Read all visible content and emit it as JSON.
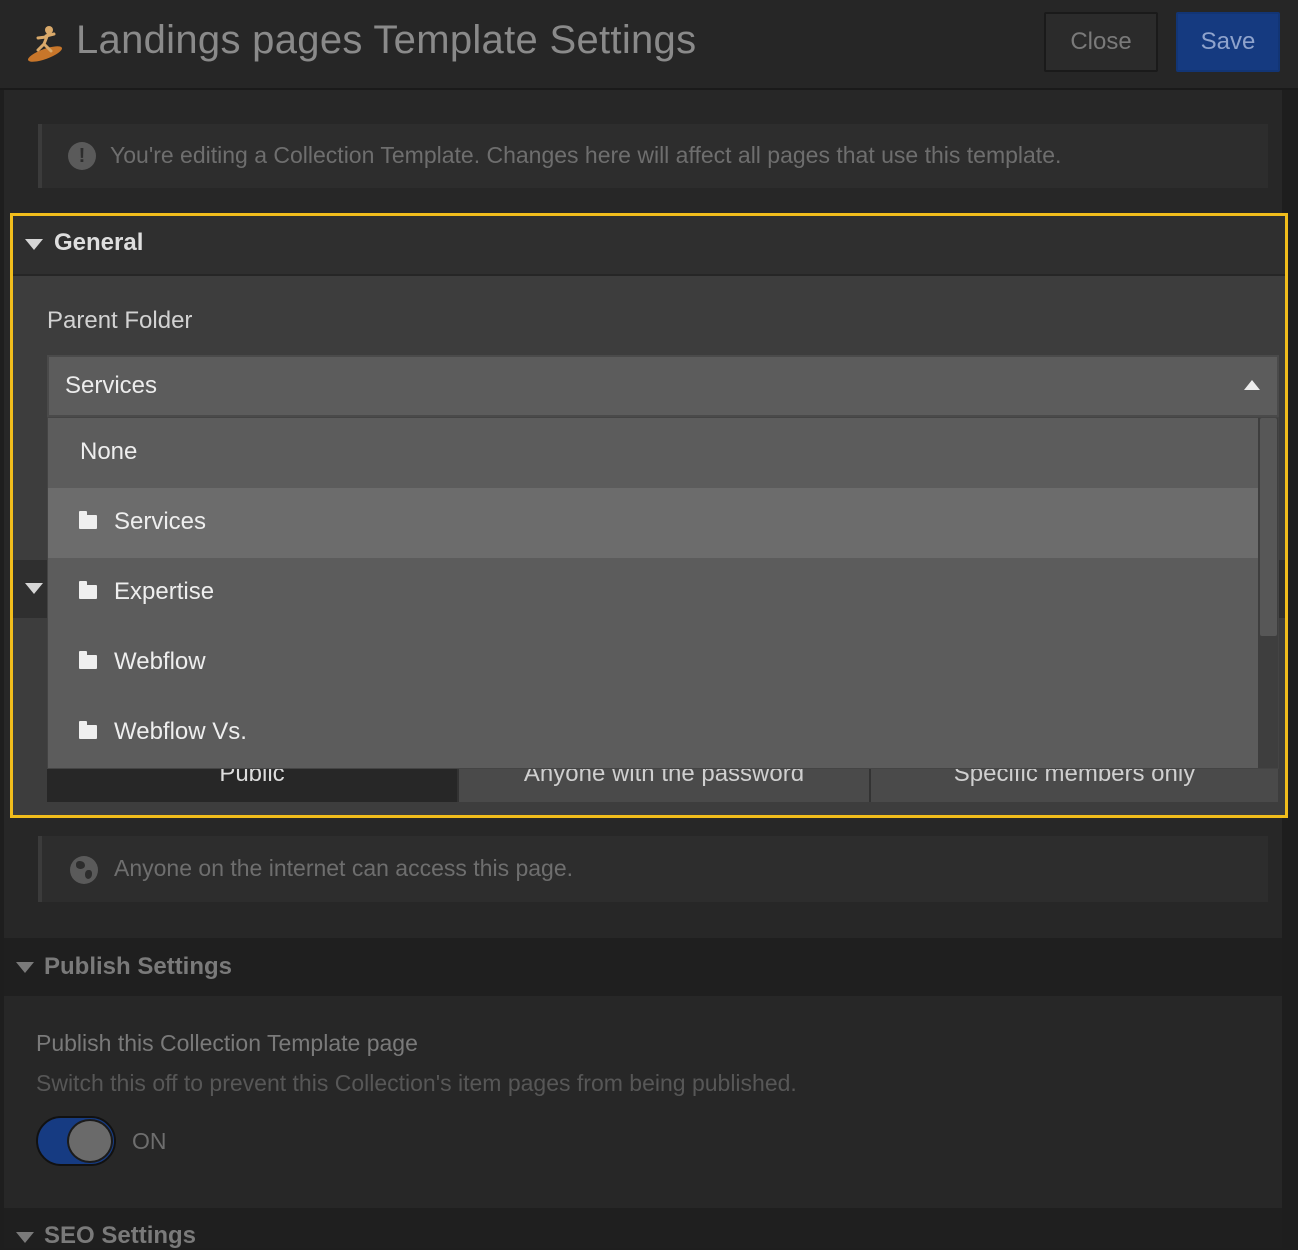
{
  "header": {
    "title": "Landings pages Template Settings",
    "close_label": "Close",
    "save_label": "Save"
  },
  "notice": {
    "text": "You're editing a Collection Template. Changes here will affect all pages that use this template."
  },
  "general": {
    "title": "General",
    "parent_folder_label": "Parent Folder",
    "parent_folder_value": "Services",
    "options": [
      {
        "label": "None"
      },
      {
        "label": "Services"
      },
      {
        "label": "Expertise"
      },
      {
        "label": "Webflow"
      },
      {
        "label": "Webflow Vs."
      }
    ],
    "access_options": [
      "Public",
      "Anyone with the password",
      "Specific members only"
    ]
  },
  "access_notice": {
    "text": "Anyone on the internet can access this page."
  },
  "publish": {
    "title": "Publish Settings",
    "setting_title": "Publish this Collection Template page",
    "setting_desc": "Switch this off to prevent this Collection's item pages from being published.",
    "toggle_state": "ON"
  },
  "seo": {
    "title": "SEO Settings"
  },
  "colors": {
    "highlight": "#f1bd1c",
    "primary_button": "#153a80",
    "toggle_on": "#163b82"
  }
}
